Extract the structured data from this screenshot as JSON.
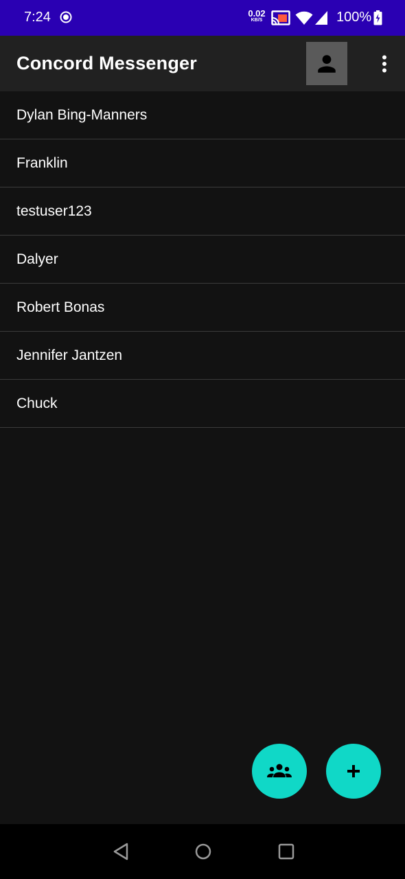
{
  "status_bar": {
    "time": "7:24",
    "net_speed_value": "0.02",
    "net_speed_unit": "KB/S",
    "battery": "100%",
    "background": "#2a00b3"
  },
  "app_bar": {
    "title": "Concord Messenger",
    "profile_icon": "person-icon",
    "overflow_icon": "more-vert-icon"
  },
  "contacts": [
    {
      "name": "Dylan Bing-Manners"
    },
    {
      "name": "Franklin"
    },
    {
      "name": "testuser123"
    },
    {
      "name": "Dalyer"
    },
    {
      "name": "Robert Bonas"
    },
    {
      "name": "Jennifer Jantzen"
    },
    {
      "name": "Chuck"
    }
  ],
  "fabs": {
    "group_icon": "group-icon",
    "add_icon": "add-icon",
    "color": "#10d8c7"
  },
  "nav_bar": {
    "back_icon": "back-icon",
    "home_icon": "home-icon",
    "recents_icon": "recents-icon"
  }
}
